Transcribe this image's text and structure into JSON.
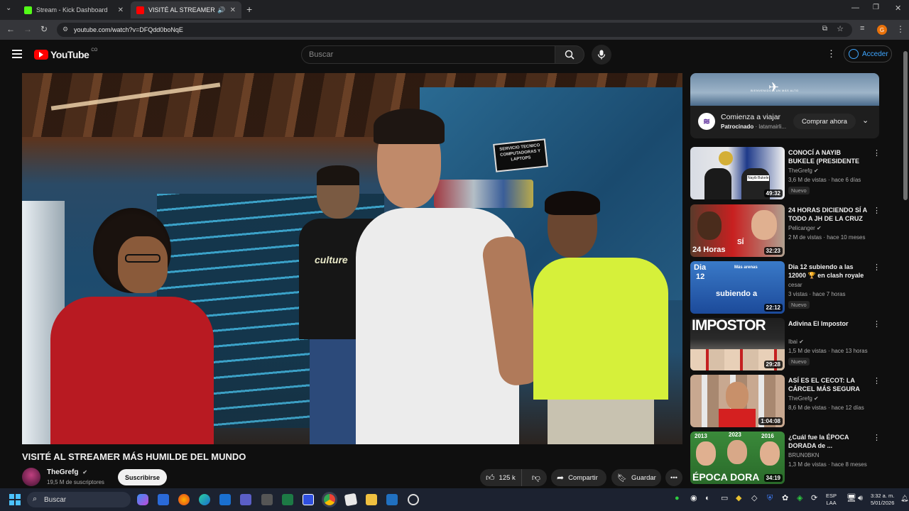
{
  "browser": {
    "tabs": [
      {
        "title": "Stream - Kick Dashboard",
        "color": "#53fc18"
      },
      {
        "title": "VISITÉ AL STREAMER MÁS H",
        "color": "#ff0000"
      }
    ],
    "url": "youtube.com/watch?v=DFQdd0boNqE",
    "profile_initial": "G"
  },
  "youtube": {
    "logo_text": "YouTube",
    "region": "CO",
    "search_placeholder": "Buscar",
    "signin_label": "Acceder"
  },
  "video": {
    "title": "VISITÉ AL STREAMER MÁS HUMILDE DEL MUNDO",
    "scene_sign": "SERVICIO TECNICO COMPUTADORAS Y LAPTOPS",
    "shirt_text": "culture",
    "channel": "TheGrefg",
    "subscribers": "19,5 M de suscriptores",
    "subscribe_label": "Suscribirse",
    "likes": "125 k",
    "share_label": "Compartir",
    "save_label": "Guardar"
  },
  "ad": {
    "title": "Comienza a viajar",
    "sponsored": "Patrocinado",
    "advertiser": "latamairli...",
    "cta": "Comprar ahora",
    "banner_text": "BIENVENIDO A UN MÁS ALTO"
  },
  "recommendations": [
    {
      "title": "CONOCÍ A NAYIB BUKELE (PRESIDENTE DE EL ...",
      "channel": "TheGrefg",
      "verified": true,
      "meta": "3,6 M de vistas · hace 6 días",
      "badge": "Nuevo",
      "duration": "49:32",
      "thumb_label": "Nayib Bukele"
    },
    {
      "title": "24 HORAS DICIENDO SÍ A TODO A JH DE LA CRUZ ...",
      "channel": "Pelicanger",
      "verified": true,
      "meta": "2 M de vistas · hace 10 meses",
      "badge": "",
      "duration": "32:23",
      "thumb_label": "24 Horas"
    },
    {
      "title": "Dia 12 subiendo a las 12000 🏆 en clash royale",
      "channel": "cesar",
      "verified": false,
      "meta": "3 vistas · hace 7 horas",
      "badge": "Nuevo",
      "duration": "22:12",
      "thumb_label": "subiendo a"
    },
    {
      "title": "Adivina El Impostor",
      "channel": "Ibai",
      "verified": true,
      "meta": "1,5 M de vistas · hace 13 horas",
      "badge": "Nuevo",
      "duration": "29:28",
      "thumb_label": "IMPOSTOR"
    },
    {
      "title": "ASÍ ES EL CECOT: LA CÁRCEL MÁS SEGURA D...",
      "channel": "TheGrefg",
      "verified": true,
      "meta": "8,6 M de vistas · hace 12 días",
      "badge": "",
      "duration": "1:04:08",
      "thumb_label": ""
    },
    {
      "title": "¿Cuál fue la ÉPOCA DORADA de ...",
      "channel": "BRUN0BKN",
      "verified": false,
      "meta": "1,3 M de vistas · hace 8 meses",
      "badge": "",
      "duration": "34:19",
      "thumb_label": "ÉPOCA DORA"
    }
  ],
  "thumb_extras": {
    "dia_prefix": "Dia",
    "dia_num": "12",
    "arenas": "Más arenas",
    "si": "SÍ",
    "years": [
      "2013",
      "2023",
      "2016"
    ]
  },
  "taskbar": {
    "search_label": "Buscar",
    "lang": "ESP",
    "lang_sub": "LAA",
    "time": "3:32 a. m.",
    "date": "5/01/2026"
  }
}
